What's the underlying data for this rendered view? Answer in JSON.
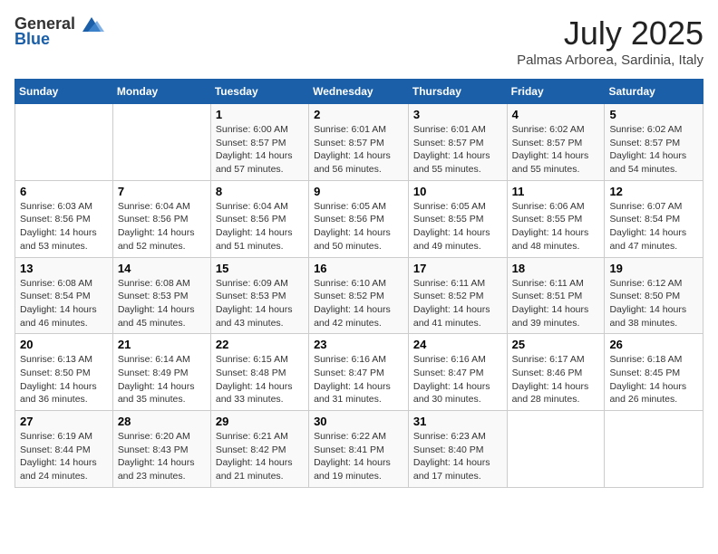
{
  "header": {
    "logo_general": "General",
    "logo_blue": "Blue",
    "month_year": "July 2025",
    "location": "Palmas Arborea, Sardinia, Italy"
  },
  "weekdays": [
    "Sunday",
    "Monday",
    "Tuesday",
    "Wednesday",
    "Thursday",
    "Friday",
    "Saturday"
  ],
  "weeks": [
    [
      {
        "day": "",
        "info": ""
      },
      {
        "day": "",
        "info": ""
      },
      {
        "day": "1",
        "info": "Sunrise: 6:00 AM\nSunset: 8:57 PM\nDaylight: 14 hours and 57 minutes."
      },
      {
        "day": "2",
        "info": "Sunrise: 6:01 AM\nSunset: 8:57 PM\nDaylight: 14 hours and 56 minutes."
      },
      {
        "day": "3",
        "info": "Sunrise: 6:01 AM\nSunset: 8:57 PM\nDaylight: 14 hours and 55 minutes."
      },
      {
        "day": "4",
        "info": "Sunrise: 6:02 AM\nSunset: 8:57 PM\nDaylight: 14 hours and 55 minutes."
      },
      {
        "day": "5",
        "info": "Sunrise: 6:02 AM\nSunset: 8:57 PM\nDaylight: 14 hours and 54 minutes."
      }
    ],
    [
      {
        "day": "6",
        "info": "Sunrise: 6:03 AM\nSunset: 8:56 PM\nDaylight: 14 hours and 53 minutes."
      },
      {
        "day": "7",
        "info": "Sunrise: 6:04 AM\nSunset: 8:56 PM\nDaylight: 14 hours and 52 minutes."
      },
      {
        "day": "8",
        "info": "Sunrise: 6:04 AM\nSunset: 8:56 PM\nDaylight: 14 hours and 51 minutes."
      },
      {
        "day": "9",
        "info": "Sunrise: 6:05 AM\nSunset: 8:56 PM\nDaylight: 14 hours and 50 minutes."
      },
      {
        "day": "10",
        "info": "Sunrise: 6:05 AM\nSunset: 8:55 PM\nDaylight: 14 hours and 49 minutes."
      },
      {
        "day": "11",
        "info": "Sunrise: 6:06 AM\nSunset: 8:55 PM\nDaylight: 14 hours and 48 minutes."
      },
      {
        "day": "12",
        "info": "Sunrise: 6:07 AM\nSunset: 8:54 PM\nDaylight: 14 hours and 47 minutes."
      }
    ],
    [
      {
        "day": "13",
        "info": "Sunrise: 6:08 AM\nSunset: 8:54 PM\nDaylight: 14 hours and 46 minutes."
      },
      {
        "day": "14",
        "info": "Sunrise: 6:08 AM\nSunset: 8:53 PM\nDaylight: 14 hours and 45 minutes."
      },
      {
        "day": "15",
        "info": "Sunrise: 6:09 AM\nSunset: 8:53 PM\nDaylight: 14 hours and 43 minutes."
      },
      {
        "day": "16",
        "info": "Sunrise: 6:10 AM\nSunset: 8:52 PM\nDaylight: 14 hours and 42 minutes."
      },
      {
        "day": "17",
        "info": "Sunrise: 6:11 AM\nSunset: 8:52 PM\nDaylight: 14 hours and 41 minutes."
      },
      {
        "day": "18",
        "info": "Sunrise: 6:11 AM\nSunset: 8:51 PM\nDaylight: 14 hours and 39 minutes."
      },
      {
        "day": "19",
        "info": "Sunrise: 6:12 AM\nSunset: 8:50 PM\nDaylight: 14 hours and 38 minutes."
      }
    ],
    [
      {
        "day": "20",
        "info": "Sunrise: 6:13 AM\nSunset: 8:50 PM\nDaylight: 14 hours and 36 minutes."
      },
      {
        "day": "21",
        "info": "Sunrise: 6:14 AM\nSunset: 8:49 PM\nDaylight: 14 hours and 35 minutes."
      },
      {
        "day": "22",
        "info": "Sunrise: 6:15 AM\nSunset: 8:48 PM\nDaylight: 14 hours and 33 minutes."
      },
      {
        "day": "23",
        "info": "Sunrise: 6:16 AM\nSunset: 8:47 PM\nDaylight: 14 hours and 31 minutes."
      },
      {
        "day": "24",
        "info": "Sunrise: 6:16 AM\nSunset: 8:47 PM\nDaylight: 14 hours and 30 minutes."
      },
      {
        "day": "25",
        "info": "Sunrise: 6:17 AM\nSunset: 8:46 PM\nDaylight: 14 hours and 28 minutes."
      },
      {
        "day": "26",
        "info": "Sunrise: 6:18 AM\nSunset: 8:45 PM\nDaylight: 14 hours and 26 minutes."
      }
    ],
    [
      {
        "day": "27",
        "info": "Sunrise: 6:19 AM\nSunset: 8:44 PM\nDaylight: 14 hours and 24 minutes."
      },
      {
        "day": "28",
        "info": "Sunrise: 6:20 AM\nSunset: 8:43 PM\nDaylight: 14 hours and 23 minutes."
      },
      {
        "day": "29",
        "info": "Sunrise: 6:21 AM\nSunset: 8:42 PM\nDaylight: 14 hours and 21 minutes."
      },
      {
        "day": "30",
        "info": "Sunrise: 6:22 AM\nSunset: 8:41 PM\nDaylight: 14 hours and 19 minutes."
      },
      {
        "day": "31",
        "info": "Sunrise: 6:23 AM\nSunset: 8:40 PM\nDaylight: 14 hours and 17 minutes."
      },
      {
        "day": "",
        "info": ""
      },
      {
        "day": "",
        "info": ""
      }
    ]
  ]
}
